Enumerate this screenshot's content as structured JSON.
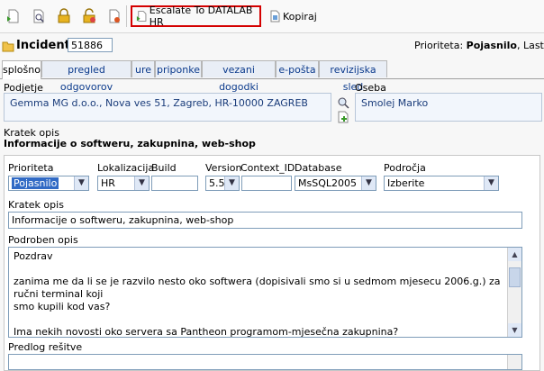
{
  "toolbar": {
    "icons": [
      "new-document-icon",
      "search-document-icon",
      "lock-icon",
      "unlock-icon",
      "delete-document-icon"
    ],
    "escalate_label": "Escalate To DATALAB HR",
    "kopiraj_label": "Kopiraj"
  },
  "incident": {
    "title": "Incident",
    "number": "51886",
    "priority_caption": "Prioriteta:",
    "priority_value": "Pojasnilo",
    "owner_caption": ", Lastnik:"
  },
  "tabs": [
    {
      "label": "splošno"
    },
    {
      "label": "pregled odgovorov"
    },
    {
      "label": "ure"
    },
    {
      "label": "priponke"
    },
    {
      "label": "vezani dogodki"
    },
    {
      "label": "e-pošta"
    },
    {
      "label": "revizijska sled"
    }
  ],
  "header": {
    "company_label": "Podjetje",
    "company_value": "Gemma MG d.o.o., Nova ves 51, Zagreb, HR-10000 ZAGREB",
    "person_label": "Oseba",
    "person_value": "Smolej Marko",
    "short_desc_label": "Kratek opis",
    "short_desc_value": "Informacije o softweru, zakupnina, web-shop"
  },
  "form": {
    "labels": {
      "prioriteta": "Prioriteta",
      "lokalizacija": "Lokalizacija",
      "build": "Build",
      "version": "Version",
      "context_id": "Context_ID",
      "database": "Database",
      "podrocja": "Področja",
      "kratek_opis": "Kratek opis",
      "podroben_opis": "Podroben opis",
      "predlog": "Predlog rešitve"
    },
    "values": {
      "prioriteta": "Pojasnilo",
      "lokalizacija": "HR",
      "build": "",
      "version": "5.5",
      "context_id": "",
      "database": "MsSQL2005",
      "podrocja": "Izberite",
      "kratek_opis": "Informacije o softweru, zakupnina, web-shop"
    },
    "podroben_lines": [
      "Pozdrav",
      "",
      "zanima me da li se je razvilo nesto oko softwera (dopisivali smo si u sedmom mjesecu 2006.g.) za ručni terminal koji",
      "smo kupili kod vas?",
      "",
      "Ima nekih novosti oko servera sa Pantheon programom-mjesečna zakupnina?"
    ]
  }
}
